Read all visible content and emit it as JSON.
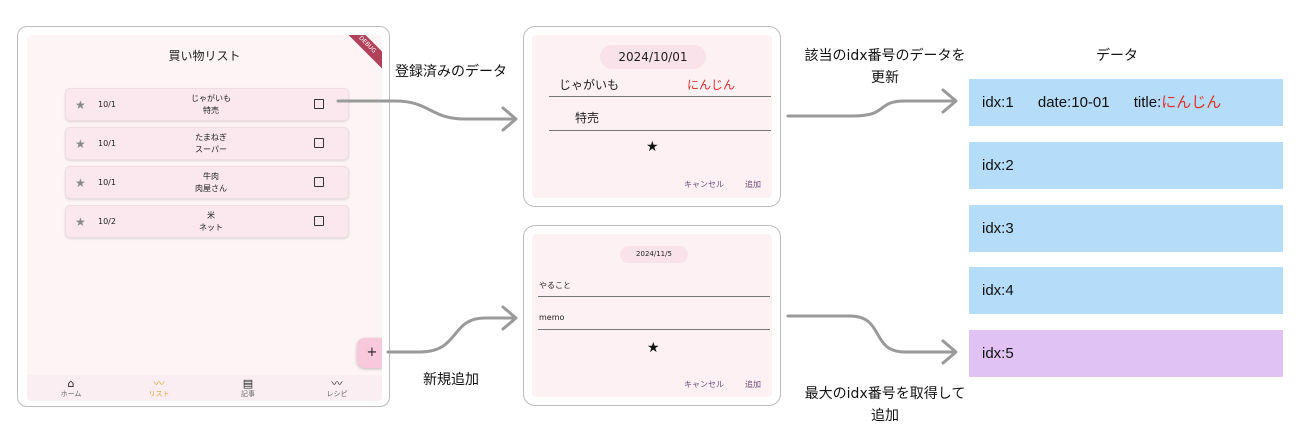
{
  "phone": {
    "title": "買い物リスト",
    "debug_badge": "DEBUG",
    "items": [
      {
        "date": "10/1",
        "name": "じゃがいも",
        "note": "特売"
      },
      {
        "date": "10/1",
        "name": "たまねぎ",
        "note": "スーパー"
      },
      {
        "date": "10/1",
        "name": "牛肉",
        "note": "肉屋さん"
      },
      {
        "date": "10/2",
        "name": "米",
        "note": "ネット"
      }
    ],
    "fab_label": "+",
    "nav": [
      {
        "label": "ホーム"
      },
      {
        "label": "リスト"
      },
      {
        "label": "記事"
      },
      {
        "label": "レシピ"
      }
    ]
  },
  "labels": {
    "registered_data": "登録済みのデータ",
    "new_add": "新規追加",
    "update_line1": "該当のidx番号のデータを",
    "update_line2": "更新",
    "max_line1": "最大のidx番号を取得して",
    "max_line2": "追加",
    "data_header": "データ"
  },
  "edit_dialog": {
    "date": "2024/10/01",
    "old_value": "じゃがいも",
    "new_value": "にんじん",
    "note": "特売",
    "star": "★",
    "cancel": "キャンセル",
    "add": "追加"
  },
  "new_dialog": {
    "date": "2024/11/5",
    "field1": "やること",
    "field2": "memo",
    "star": "★",
    "cancel": "キャンセル",
    "add": "追加"
  },
  "data_rows": [
    {
      "idx": "idx:1",
      "date": "date:10-01",
      "title_label": "title:",
      "title_value": "にんじん"
    },
    {
      "idx": "idx:2"
    },
    {
      "idx": "idx:3"
    },
    {
      "idx": "idx:4"
    },
    {
      "idx": "idx:5"
    }
  ],
  "colors": {
    "data_blue": "#b5dcf9",
    "data_purple": "#e0c3f4",
    "highlight_red": "#e0312c",
    "arrow_gray": "#9a9a9a"
  }
}
